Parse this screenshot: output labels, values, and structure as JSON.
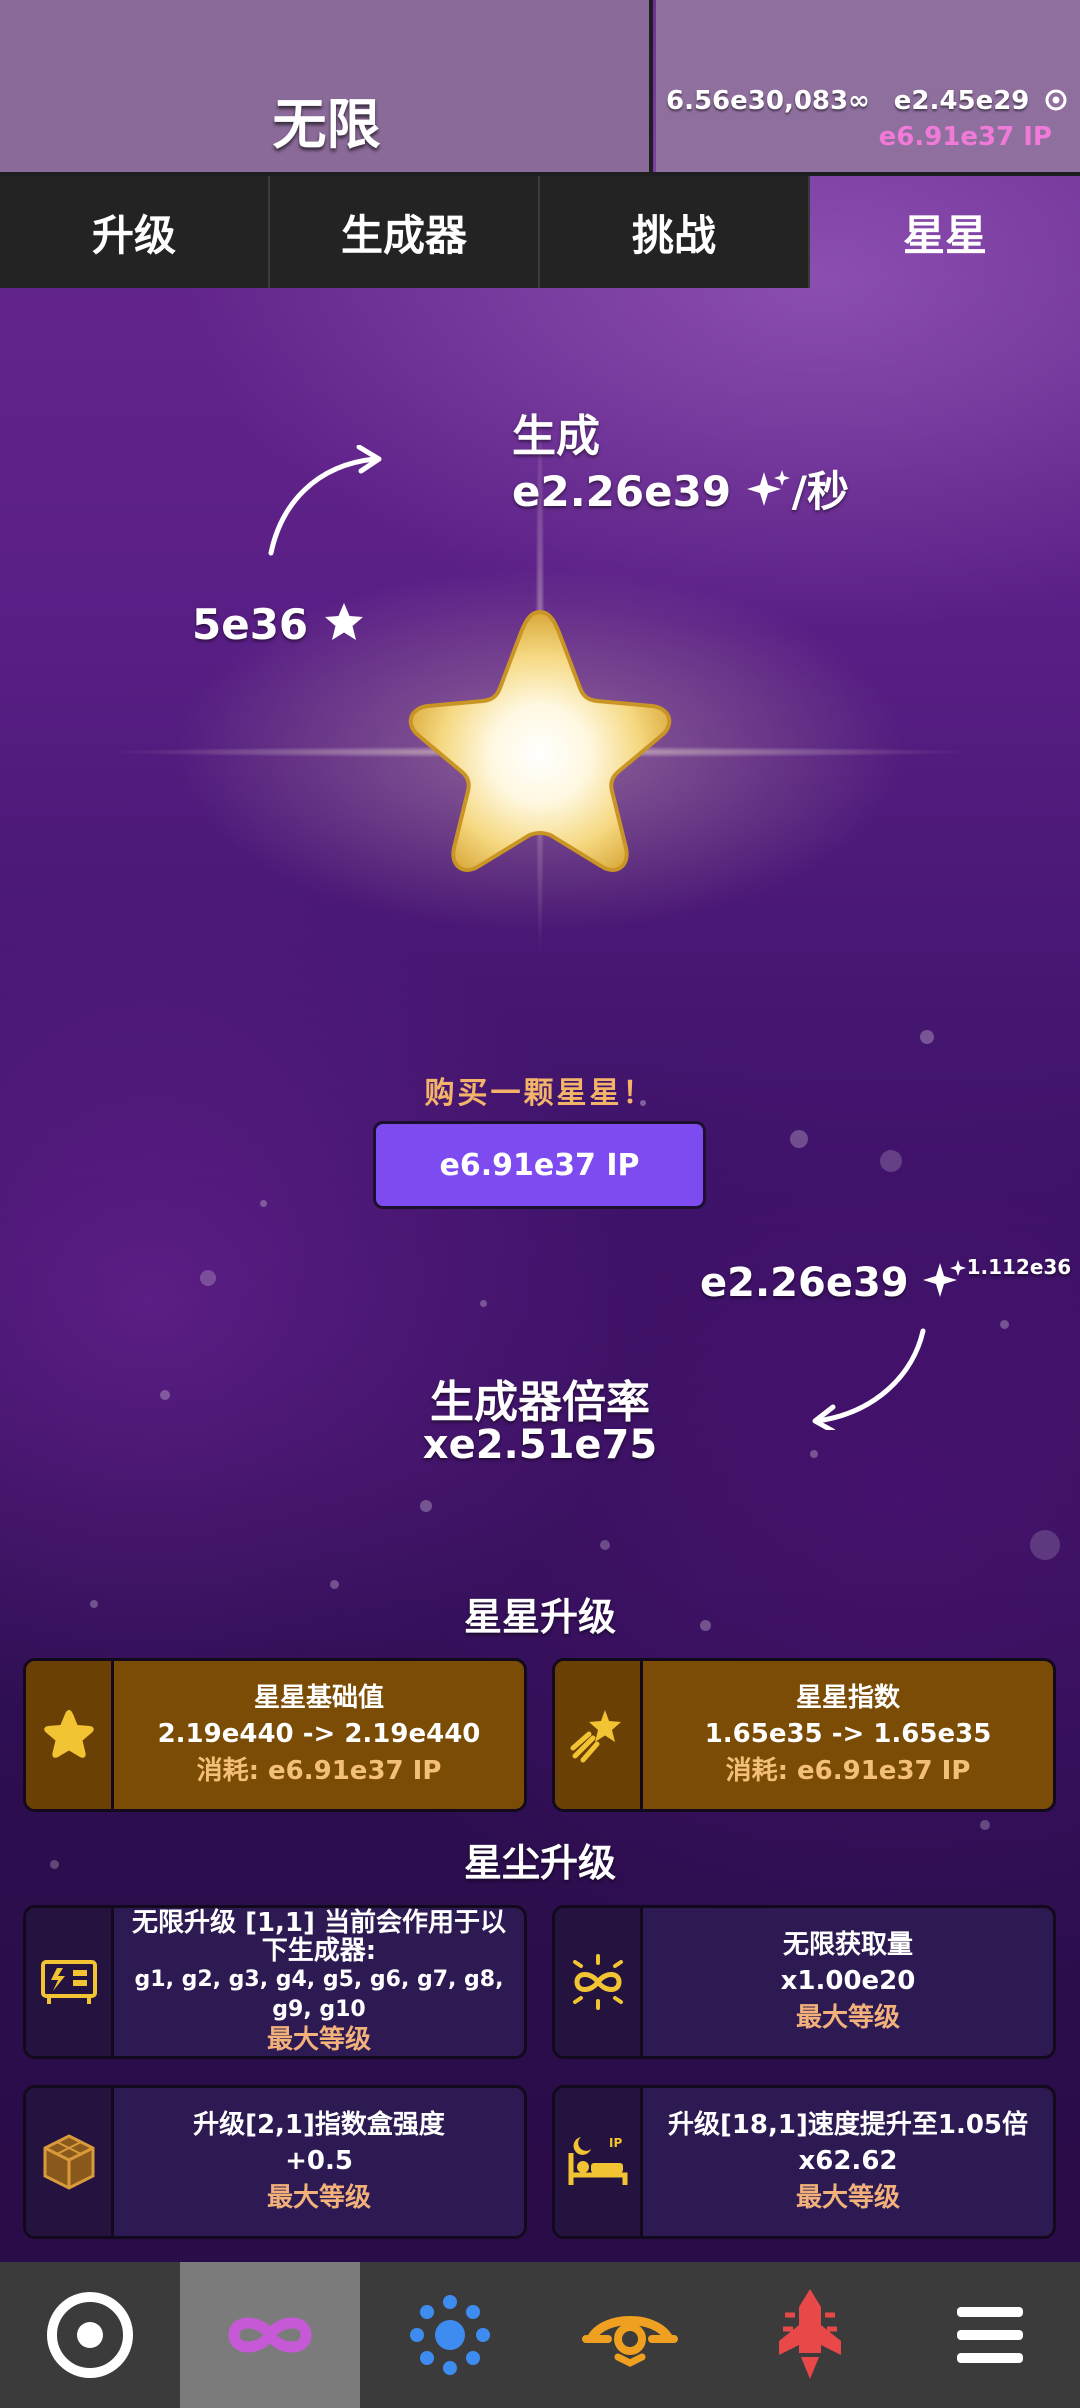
{
  "header": {
    "title": "无限",
    "resource_primary": "6.56e30,083∞",
    "resource_secondary": "e2.45e29",
    "ip_amount": "e6.91e37 IP"
  },
  "tabs": [
    {
      "label": "升级"
    },
    {
      "label": "生成器"
    },
    {
      "label": "挑战"
    },
    {
      "label": "星星"
    }
  ],
  "star": {
    "gen_label": "生成",
    "gen_rate": "e2.26e39",
    "gen_rate_unit": "/秒",
    "star_count": "5e36",
    "buy_prompt": "购买一颗星星！",
    "buy_cost": "e6.91e37 IP",
    "dust_amount": "e2.26e39",
    "dust_exponent": "1.112e36",
    "multiplier_label": "生成器倍率",
    "multiplier_value": "xe2.51e75"
  },
  "star_upgrades": {
    "title": "星星升级",
    "items": [
      {
        "title": "星星基础值",
        "value": "2.19e440 -> 2.19e440",
        "cost": "消耗: e6.91e37 IP",
        "icon": "star-icon"
      },
      {
        "title": "星星指数",
        "value": "1.65e35 -> 1.65e35",
        "cost": "消耗: e6.91e37 IP",
        "icon": "shooting-star-icon"
      }
    ]
  },
  "dust_upgrades": {
    "title": "星尘升级",
    "items": [
      {
        "title": "无限升级 [1,1] 当前会作用于以下生成器:",
        "value": "g1, g2, g3, g4, g5, g6, g7, g8, g9, g10",
        "status": "最大等级",
        "icon": "generator-icon"
      },
      {
        "title": "无限获取量",
        "value": "x1.00e20",
        "status": "最大等级",
        "icon": "infinity-gain-icon"
      },
      {
        "title": "升级[2,1]指数盒强度",
        "value": "+0.5",
        "status": "最大等级",
        "icon": "cube-icon"
      },
      {
        "title": "升级[18,1]速度提升至1.05倍",
        "value": "x62.62",
        "status": "最大等级",
        "icon": "sleep-ip-icon"
      }
    ]
  },
  "bottom_nav": [
    {
      "name": "prestige-icon",
      "color": "#ffffff"
    },
    {
      "name": "infinity-icon",
      "color": "#c65ad6"
    },
    {
      "name": "dots-icon",
      "color": "#3f8cf0"
    },
    {
      "name": "eye-icon",
      "color": "#f0a020"
    },
    {
      "name": "rocket-icon",
      "color": "#e84848"
    },
    {
      "name": "menu-icon",
      "color": "#ffffff"
    }
  ],
  "colors": {
    "accent_purple": "#7d4bf0",
    "ip_pink": "#f07ad8",
    "gold_card": "#7a4c05",
    "purple_card": "#2d1a52",
    "cost_text": "#f4c078"
  }
}
